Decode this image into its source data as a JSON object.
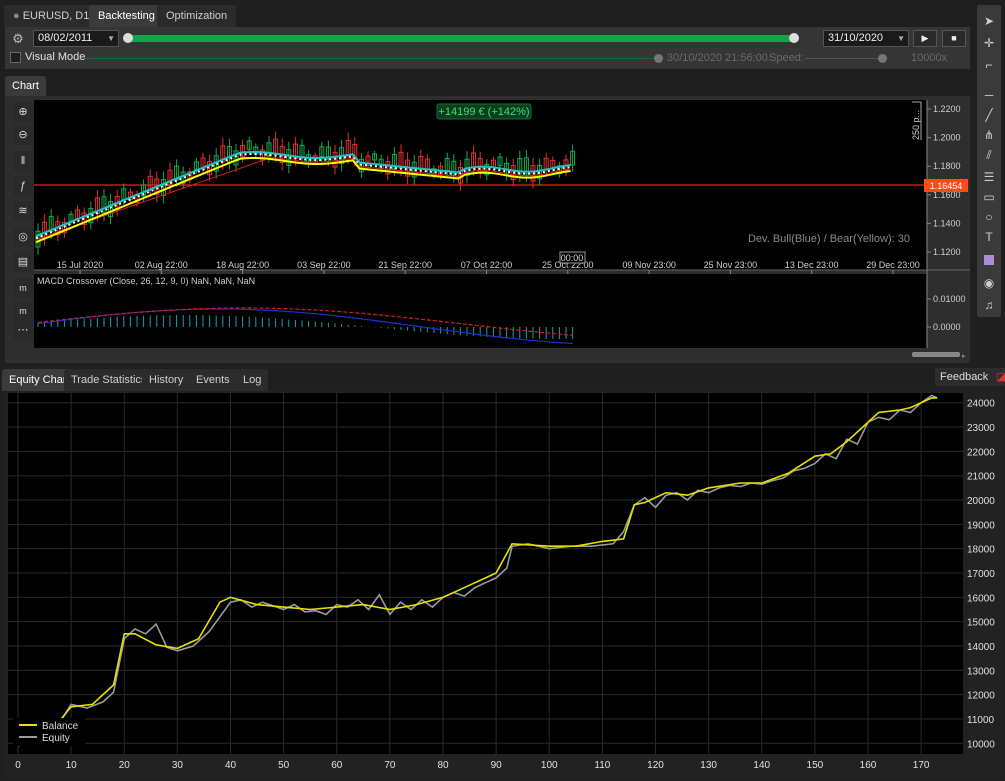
{
  "tabs": {
    "symbol": "EURUSD, D1",
    "backtesting": "Backtesting",
    "optimization": "Optimization"
  },
  "toolbar": {
    "start_date": "08/02/2011",
    "end_date": "31/10/2020",
    "visual_mode": "Visual Mode",
    "current_time": "30/10/2020 21:56:00",
    "speed_label": "Speed:",
    "speed_value": "10000x",
    "progress": 1.0
  },
  "chart_panel": {
    "tab": "Chart",
    "profit_badge": "+14199 € (+142%)",
    "scale_label": "250 p...",
    "price_ticks": [
      "1.2200",
      "1.2000",
      "1.1800",
      "1.1600",
      "1.1400",
      "1.1200"
    ],
    "current_price": "1.16454",
    "indicator_label": "Dev. Bull(Blue) / Bear(Yellow):  30",
    "date_ticks": [
      "15 Jul 2020",
      "02 Aug 22:00",
      "18 Aug 22:00",
      "03 Sep 22:00",
      "21 Sep 22:00",
      "07 Oct 22:00",
      "25 Oct 22:00",
      "09 Nov 23:00",
      "25 Nov 23:00",
      "13 Dec 23:00",
      "29 Dec 23:00"
    ],
    "cursor_time": "00:00",
    "macd_label": "MACD Crossover (Close, 26, 12, 9, 0) NaN, NaN, NaN",
    "macd_ticks": [
      "0.01000",
      "0.0000"
    ],
    "colors": {
      "bull": "#23c0c8",
      "bear": "#ffff00",
      "price_line": "#ff3b1f",
      "up": "#1aa84a",
      "down": "#e03030"
    }
  },
  "bottom_tabs": [
    "Equity Chart",
    "Trade Statistics",
    "History",
    "Events",
    "Log"
  ],
  "feedback": "Feedback",
  "chart_data": {
    "type": "line",
    "xlabel": "",
    "ylabel": "",
    "x_ticks": [
      0,
      10,
      20,
      30,
      40,
      50,
      60,
      70,
      80,
      90,
      100,
      110,
      120,
      130,
      140,
      150,
      160,
      170
    ],
    "y_ticks": [
      10000,
      11000,
      12000,
      13000,
      14000,
      15000,
      16000,
      17000,
      18000,
      19000,
      20000,
      21000,
      22000,
      23000,
      24000
    ],
    "xlim": [
      0,
      176
    ],
    "ylim": [
      9600,
      24400
    ],
    "legend": [
      "Balance",
      "Equity"
    ],
    "series": [
      {
        "name": "Balance",
        "color": "#e8e000",
        "x": [
          0,
          4,
          7,
          10,
          14,
          18,
          20,
          22,
          26,
          30,
          34,
          38,
          40,
          45,
          50,
          55,
          60,
          65,
          70,
          75,
          80,
          85,
          90,
          93,
          100,
          105,
          110,
          114,
          116,
          118,
          122,
          126,
          130,
          136,
          140,
          145,
          150,
          153,
          156,
          159,
          162,
          166,
          168,
          172,
          173
        ],
        "y": [
          10000,
          10000,
          10700,
          11500,
          11600,
          12400,
          14500,
          14500,
          14050,
          13900,
          14300,
          15800,
          16000,
          15700,
          15600,
          15500,
          15600,
          15700,
          15500,
          15700,
          16000,
          16500,
          17000,
          18200,
          18100,
          18100,
          18300,
          18400,
          19800,
          19900,
          20300,
          20200,
          20500,
          20700,
          20700,
          21100,
          21800,
          21900,
          22400,
          23000,
          23600,
          23700,
          23800,
          24200,
          24200
        ]
      },
      {
        "name": "Equity",
        "color": "#9a9a9a",
        "x": [
          0,
          4,
          6,
          8,
          10,
          13,
          16,
          18,
          20,
          22,
          24,
          26,
          28,
          30,
          33,
          36,
          38,
          40,
          42,
          44,
          46,
          48,
          50,
          52,
          54,
          56,
          58,
          60,
          62,
          64,
          66,
          68,
          70,
          72,
          74,
          76,
          78,
          80,
          82,
          84,
          86,
          88,
          90,
          92,
          93,
          96,
          100,
          104,
          108,
          112,
          114,
          116,
          118,
          120,
          122,
          124,
          126,
          128,
          130,
          132,
          134,
          136,
          138,
          140,
          142,
          144,
          146,
          148,
          150,
          152,
          154,
          156,
          158,
          160,
          162,
          164,
          166,
          168,
          170,
          172,
          173
        ],
        "y": [
          9900,
          10100,
          10600,
          10900,
          11600,
          11450,
          11700,
          12100,
          14300,
          14700,
          14500,
          14900,
          13950,
          13800,
          14000,
          14600,
          15200,
          15800,
          15900,
          15600,
          15800,
          15650,
          15500,
          15700,
          15400,
          15450,
          15300,
          15700,
          15600,
          15900,
          15500,
          16100,
          15300,
          15800,
          15500,
          15900,
          15600,
          16000,
          16200,
          16050,
          16400,
          16600,
          16800,
          17200,
          18100,
          18200,
          18000,
          18100,
          18100,
          18200,
          18700,
          19800,
          20100,
          19700,
          20200,
          20300,
          20000,
          20400,
          20300,
          20500,
          20600,
          20550,
          20700,
          20650,
          20800,
          20900,
          21200,
          21300,
          21500,
          21900,
          21700,
          22500,
          22300,
          23200,
          23400,
          23300,
          23700,
          23600,
          24000,
          24300,
          24200
        ]
      }
    ]
  }
}
